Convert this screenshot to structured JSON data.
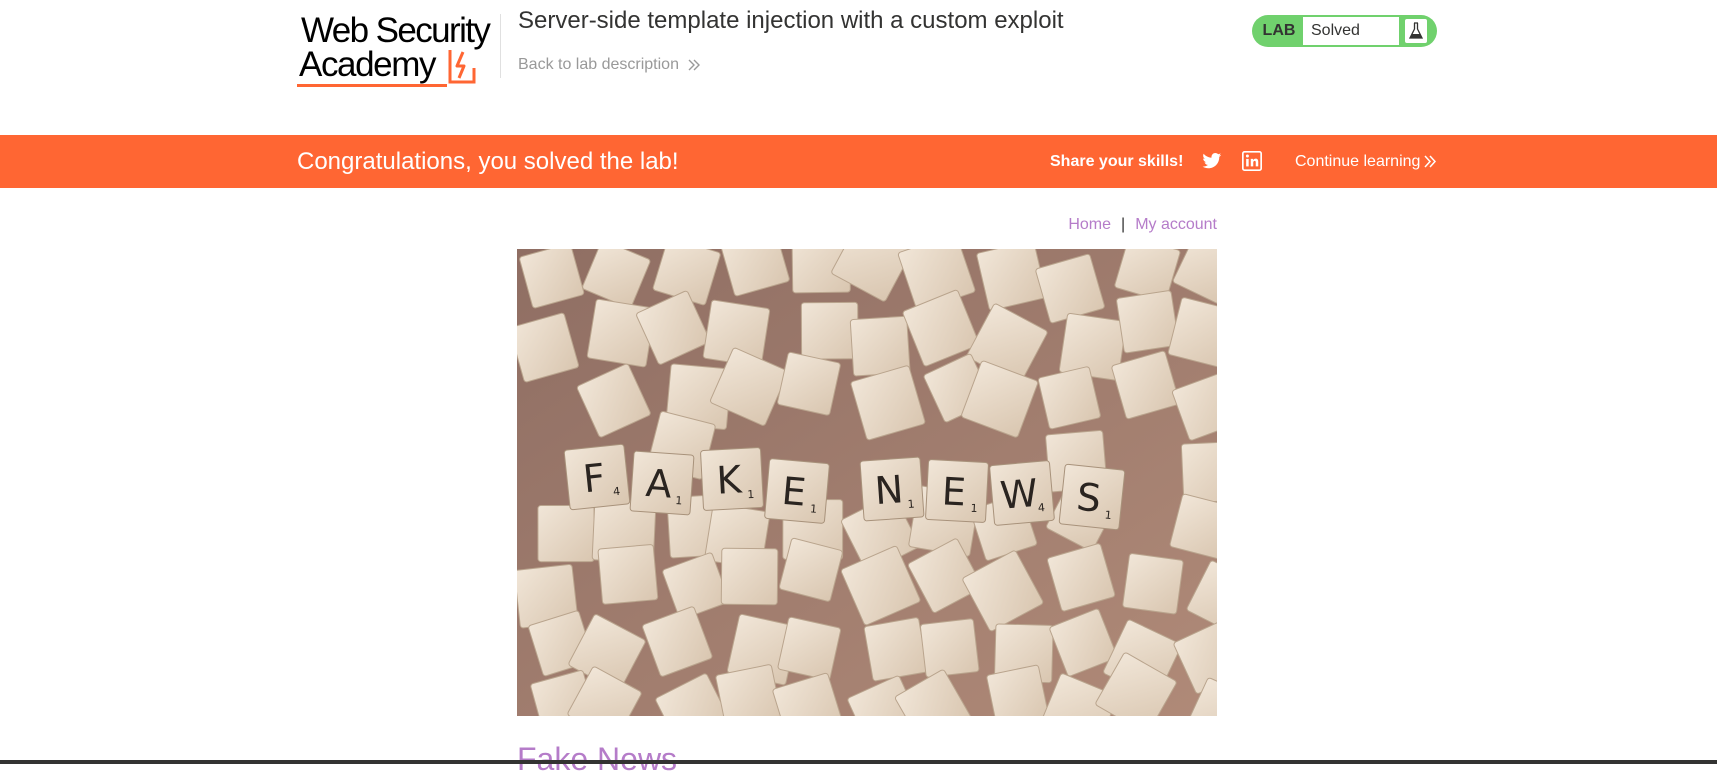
{
  "header": {
    "logo_line1": "Web Security",
    "logo_line2": "Academy",
    "lab_title": "Server-side template injection with a custom exploit",
    "back_link": "Back to lab description",
    "lab_status": {
      "tag": "LAB",
      "value": "Solved"
    }
  },
  "banner": {
    "message": "Congratulations, you solved the lab!",
    "share_label": "Share your skills!",
    "twitter_icon": "twitter-icon",
    "linkedin_icon": "linkedin-icon",
    "continue_label": "Continue learning"
  },
  "nav": {
    "home": "Home",
    "separator": "|",
    "my_account": "My account"
  },
  "post": {
    "title": "Fake News",
    "image_letters": [
      "F",
      "A",
      "K",
      "E",
      "N",
      "E",
      "W",
      "S"
    ],
    "image_scores": [
      "4",
      "1",
      "1",
      "1",
      "1",
      "1",
      "4",
      "1"
    ]
  },
  "colors": {
    "brand_orange": "#ff6633",
    "status_green": "#70d16d",
    "link_purple": "#b57cc9"
  }
}
